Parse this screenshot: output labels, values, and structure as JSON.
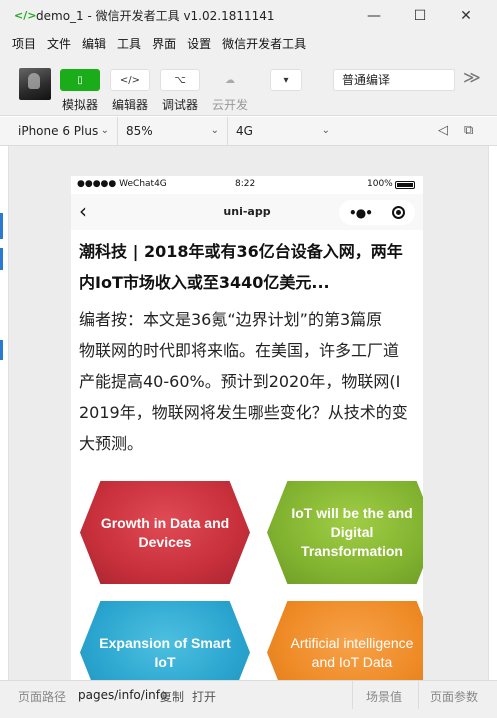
{
  "window": {
    "app_icon": "</>",
    "title": "demo_1 - 微信开发者工具 v1.02.1811141",
    "minimize_icon": "—",
    "maximize_icon": "☐",
    "close_icon": "✕"
  },
  "menu": {
    "items": [
      "项目",
      "文件",
      "编辑",
      "工具",
      "界面",
      "设置",
      "微信开发者工具"
    ]
  },
  "toolbar": {
    "simulator": {
      "icon": "▯",
      "label": "模拟器"
    },
    "editor": {
      "icon": "</>",
      "label": "编辑器"
    },
    "debugger": {
      "icon": "⌥",
      "label": "调试器"
    },
    "cloud": {
      "icon": "☁",
      "label": "云开发"
    },
    "more_select": {
      "icon": "▾"
    },
    "compile_mode": "普通编译",
    "overflow_icon": "≫"
  },
  "devicebar": {
    "device": "iPhone 6 Plus",
    "zoom": "85%",
    "network": "4G",
    "chevron": "⌄",
    "sound_icon": "◁",
    "popout_icon": "⧉"
  },
  "phone": {
    "status": {
      "signal": "●●●●● WeChat4G",
      "time": "8:22",
      "battery": "100%"
    },
    "nav": {
      "back_icon": "‹",
      "title": "uni-app",
      "menu_icon": "•●•",
      "colors": {
        "capsule": "#ffffff"
      }
    },
    "article": {
      "headline_line1": "潮科技 | 2018年或有36亿台设备入网，两年",
      "headline_line2": "内IoT市场收入或至3440亿美元...",
      "body_lines": [
        "编者按：本文是36氪“边界计划”的第3篇原",
        "物联网的时代即将来临。在美国，许多工厂道",
        "产能提高40-60%。预计到2020年，物联网(I",
        "2019年，物联网将发生哪些变化？从技术的变",
        "大预测。"
      ]
    },
    "infographic": {
      "hex1": "Growth in Data and Devices",
      "hex2": "IoT will be the and Digital Transformation",
      "hex3": "Expansion of Smart IoT",
      "hex4": "Artificial intelligence and IoT Data"
    }
  },
  "bottom": {
    "path_label": "页面路径",
    "path_value": "pages/info/info",
    "copy": "复制",
    "open": "打开",
    "scene": "场景值",
    "params": "页面参数"
  }
}
